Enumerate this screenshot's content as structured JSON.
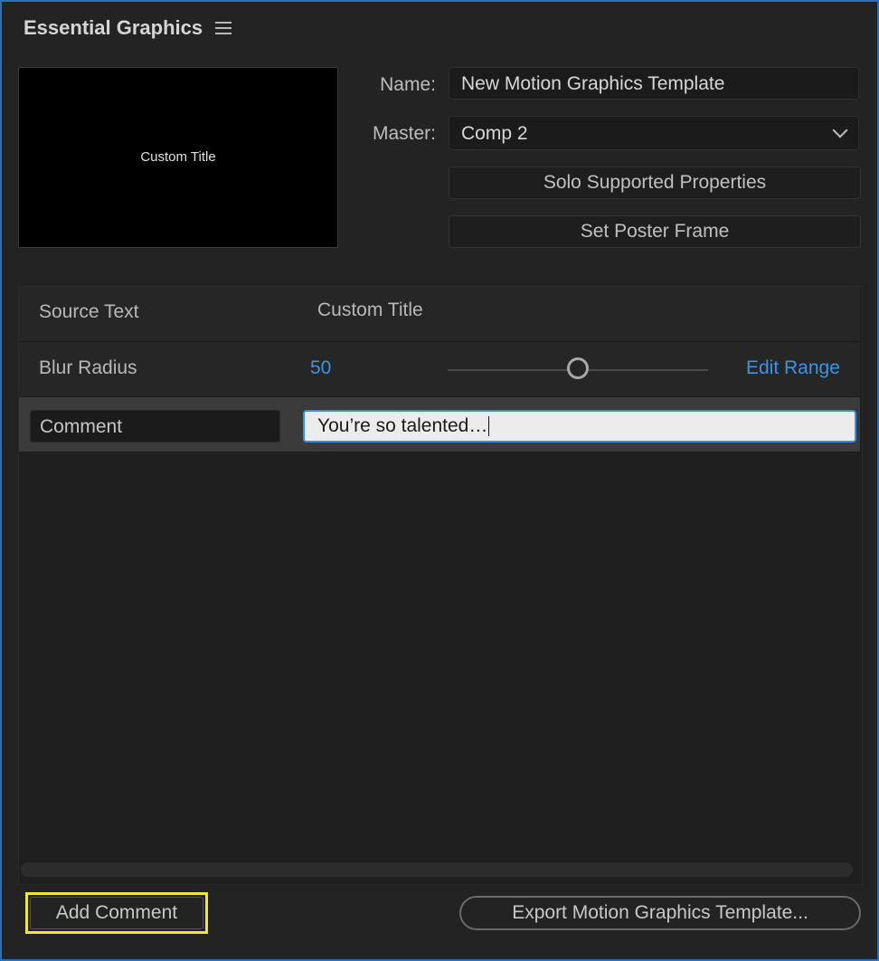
{
  "panel": {
    "title": "Essential Graphics"
  },
  "preview": {
    "text": "Custom Title"
  },
  "form": {
    "name_label": "Name:",
    "name_value": "New Motion Graphics Template",
    "master_label": "Master:",
    "master_value": "Comp 2",
    "solo_button": "Solo Supported Properties",
    "poster_button": "Set Poster Frame"
  },
  "properties": [
    {
      "label": "Source Text",
      "value": "Custom Title"
    },
    {
      "label": "Blur Radius",
      "value": "50",
      "slider_fraction": 0.5,
      "edit_range": "Edit Range"
    },
    {
      "label": "Comment",
      "value": "You’re so talented…"
    }
  ],
  "footer": {
    "add_comment": "Add Comment",
    "export": "Export Motion Graphics Template..."
  },
  "colors": {
    "accent_blue": "#3b95e2",
    "highlight_yellow": "#f0e53c",
    "panel_border": "#2d6fb5"
  }
}
